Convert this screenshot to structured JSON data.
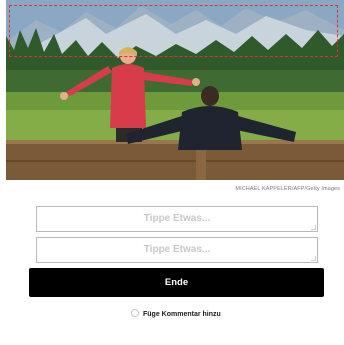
{
  "photo": {
    "credit_text": "MICHAEL KAPPELER/AFP/Getty Images",
    "alt_subject": "photo"
  },
  "inputs": [
    {
      "placeholder": "Tippe Etwas...",
      "value": ""
    },
    {
      "placeholder": "Tippe Etwas...",
      "value": ""
    }
  ],
  "end_button": {
    "label": "Ende"
  },
  "comment_option": {
    "label": "Füge Kommentar hinzu",
    "checked": false
  },
  "colors": {
    "selection_border": "#e23030",
    "button_bg": "#000000",
    "button_text": "#ffffff"
  }
}
